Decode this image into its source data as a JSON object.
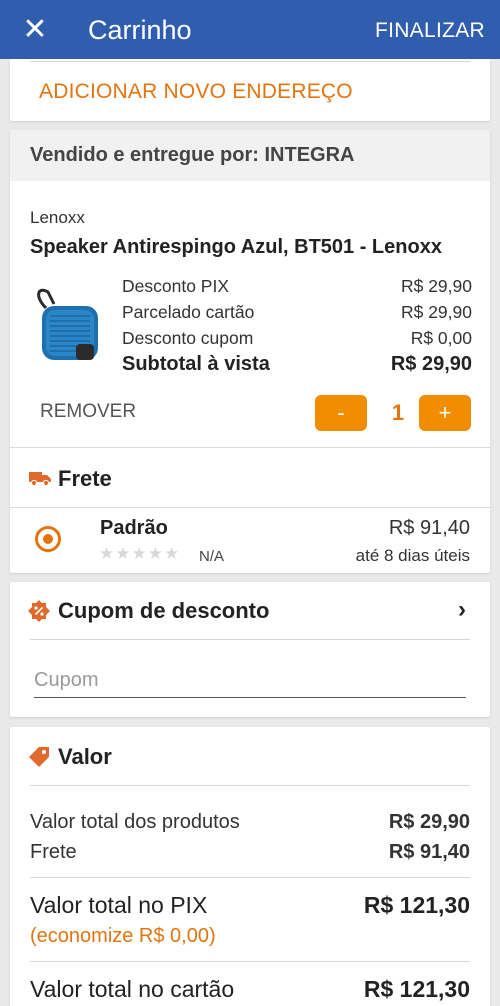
{
  "appbar": {
    "close_icon": "✕",
    "title": "Carrinho",
    "finish_label": "FINALIZAR"
  },
  "address": {
    "add_label": "ADICIONAR NOVO ENDEREÇO"
  },
  "seller": {
    "label": "Vendido e entregue por: INTEGRA"
  },
  "product": {
    "brand": "Lenoxx",
    "name": "Speaker Antirespingo Azul, BT501 - Lenoxx",
    "image_icon": "blue-speaker-image",
    "prices": [
      {
        "label": "Desconto PIX",
        "value": "R$ 29,90"
      },
      {
        "label": "Parcelado cartão",
        "value": "R$ 29,90"
      },
      {
        "label": "Desconto cupom",
        "value": "R$ 0,00"
      }
    ],
    "subtotal": {
      "label": "Subtotal à vista",
      "value": "R$ 29,90"
    },
    "remove_label": "REMOVER",
    "minus_label": "-",
    "quantity": "1",
    "plus_label": "+"
  },
  "shipping": {
    "title": "Frete",
    "icon": "truck-icon",
    "option": {
      "name": "Padrão",
      "rating_stars": "★★★★★",
      "rating": 0,
      "rating_text": "N/A",
      "price": "R$ 91,40",
      "eta": "até 8 dias úteis",
      "selected": true
    }
  },
  "coupon": {
    "title": "Cupom de desconto",
    "icon": "discount-badge-icon",
    "chevron": "›",
    "placeholder": "Cupom",
    "value": ""
  },
  "summary": {
    "title": "Valor",
    "icon": "price-tag-icon",
    "products_label": "Valor total dos produtos",
    "products_value": "R$ 29,90",
    "shipping_label": "Frete",
    "shipping_value": "R$ 91,40",
    "pix_label": "Valor total no PIX",
    "pix_value": "R$ 121,30",
    "savings": "(economize R$ 0,00)",
    "card_label": "Valor total no cartão",
    "card_value": "R$ 121,30"
  },
  "colors": {
    "appbar": "#2f5eaf",
    "accent": "#e4740f",
    "button": "#f28c00"
  }
}
